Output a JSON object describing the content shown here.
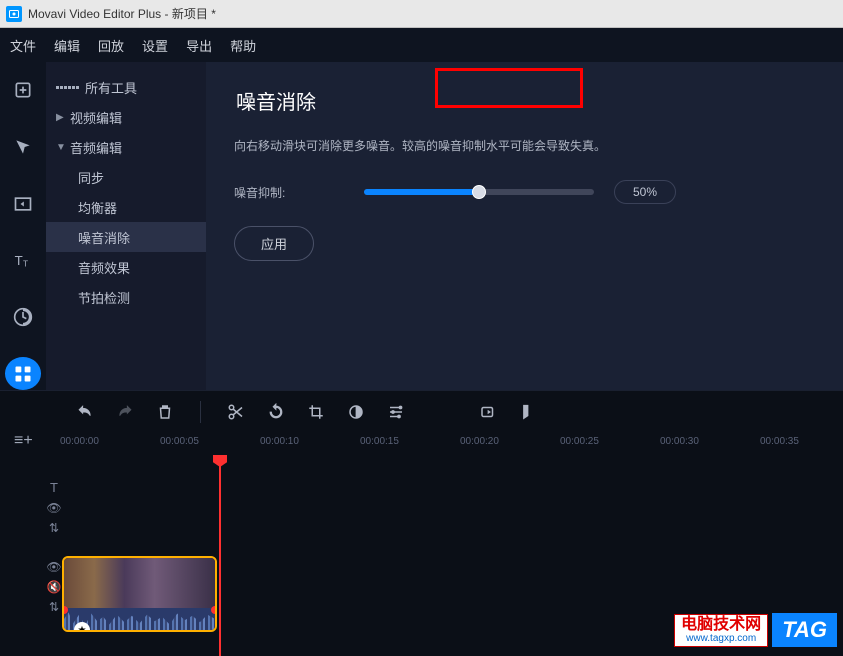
{
  "titlebar": {
    "app_name": "Movavi Video Editor Plus",
    "project": "新项目 *"
  },
  "menubar": [
    "文件",
    "编辑",
    "回放",
    "设置",
    "导出",
    "帮助"
  ],
  "sidebar": {
    "all_tools": "所有工具",
    "video_edit": "视频编辑",
    "audio_edit": "音频编辑",
    "children": [
      "同步",
      "均衡器",
      "噪音消除",
      "音频效果",
      "节拍检测"
    ]
  },
  "panel": {
    "title": "噪音消除",
    "desc": "向右移动滑块可消除更多噪音。较高的噪音抑制水平可能会导致失真。",
    "slider_label": "噪音抑制:",
    "slider_value": "50%",
    "apply": "应用"
  },
  "timeline": {
    "ticks": [
      "00:00:00",
      "00:00:05",
      "00:00:10",
      "00:00:15",
      "00:00:20",
      "00:00:25",
      "00:00:30",
      "00:00:35"
    ]
  },
  "watermark": {
    "line1": "电脑技术网",
    "line2": "www.tagxp.com",
    "tag": "TAG"
  }
}
